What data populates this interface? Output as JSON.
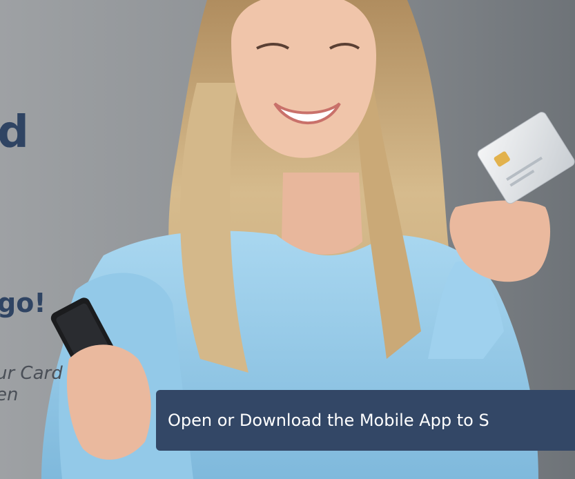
{
  "hero": {
    "headline": "d",
    "subhead": "go!",
    "tagline_line1": "ur Card",
    "tagline_line2": "en"
  },
  "cta": {
    "label": "Open or Download the Mobile App to S"
  },
  "colors": {
    "brand_navy": "#334766",
    "headline": "#2f4463",
    "background": "#8d9093",
    "sweater": "#8fc6e6"
  }
}
